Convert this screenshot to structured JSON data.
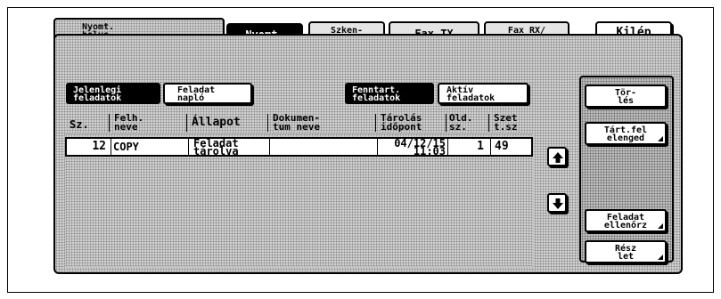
{
  "tabs": {
    "place": "Nyomt.\nhelye",
    "print": "Nyomt.",
    "scan": "Szken-\nnelés",
    "fax_tx": "Fax TX",
    "fax_rx": "Fax RX/\nFelh.fiók"
  },
  "exit_label": "Kilép",
  "filters": {
    "current_jobs": "Jelenlegi\nfeladatok",
    "job_log": "Feladat\nnapló",
    "reserved_jobs": "Fenntart.\nfeladatok",
    "active_jobs": "Aktív\nfeladatok"
  },
  "columns": {
    "no": "Sz.",
    "user": "Felh.\nneve",
    "status": "Állapot",
    "doc": "Dokumen-\ntum neve",
    "time": "Tárolás\nidőpont",
    "pages": "Old.\nsz.",
    "copies": "Szet\nt.sz"
  },
  "rows": [
    {
      "no": "12",
      "user": "COPY",
      "status": "Feladat\ntárolva",
      "doc": "",
      "time": "04/12/15\n11:03",
      "pages": "1",
      "copies": "49"
    }
  ],
  "side_buttons": {
    "delete": "Tör-\nlés",
    "release": "Tárt.fel\nelenged",
    "check": "Feladat\nellenőrz",
    "details": "Rész\nlet"
  }
}
